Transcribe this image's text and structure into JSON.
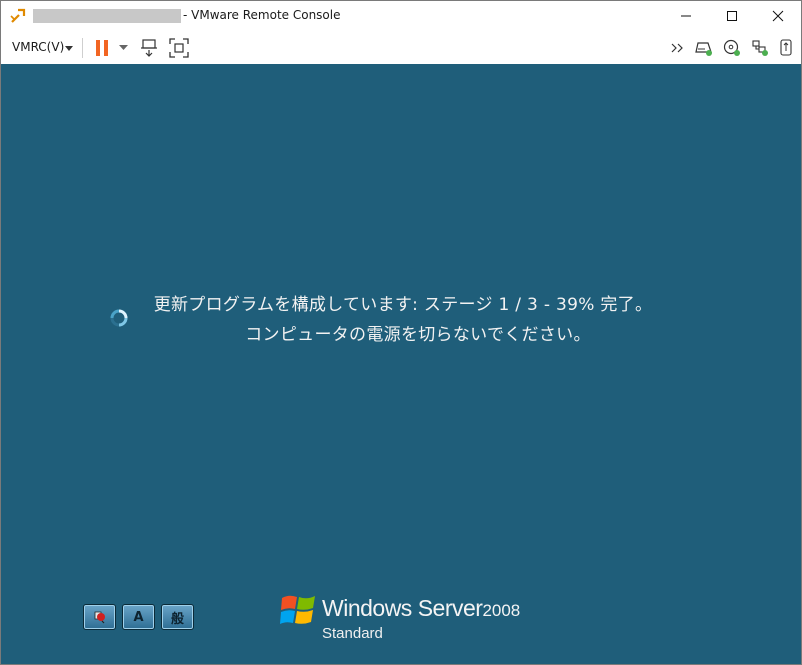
{
  "window": {
    "title": "- VMware Remote Console"
  },
  "titlebar_buttons": {
    "minimize": "minimize-icon",
    "maximize": "maximize-icon",
    "close": "close-icon"
  },
  "toolbar": {
    "menu_label": "VMRC(V)",
    "left_icons": [
      "pause-icon",
      "dropdown-caret-icon",
      "send-ctrl-alt-del-icon",
      "fullscreen-icon"
    ],
    "right_icons": [
      "overflow-icon",
      "hard-disk-icon",
      "cd-dvd-icon",
      "network-adapter-icon",
      "usb-icon"
    ]
  },
  "console": {
    "background": "#1f5e7a",
    "status_line1": "更新プログラムを構成しています: ステージ 1 / 3 - 39% 完了。",
    "status_line2": "コンピュータの電源を切らないでください。",
    "ime_buttons": [
      "",
      "A",
      "般"
    ],
    "logo_title": "Windows Server",
    "logo_year": "2008",
    "logo_edition": "Standard"
  },
  "colors": {
    "pause_accent": "#f26522",
    "status_dot": "#4caf50"
  }
}
